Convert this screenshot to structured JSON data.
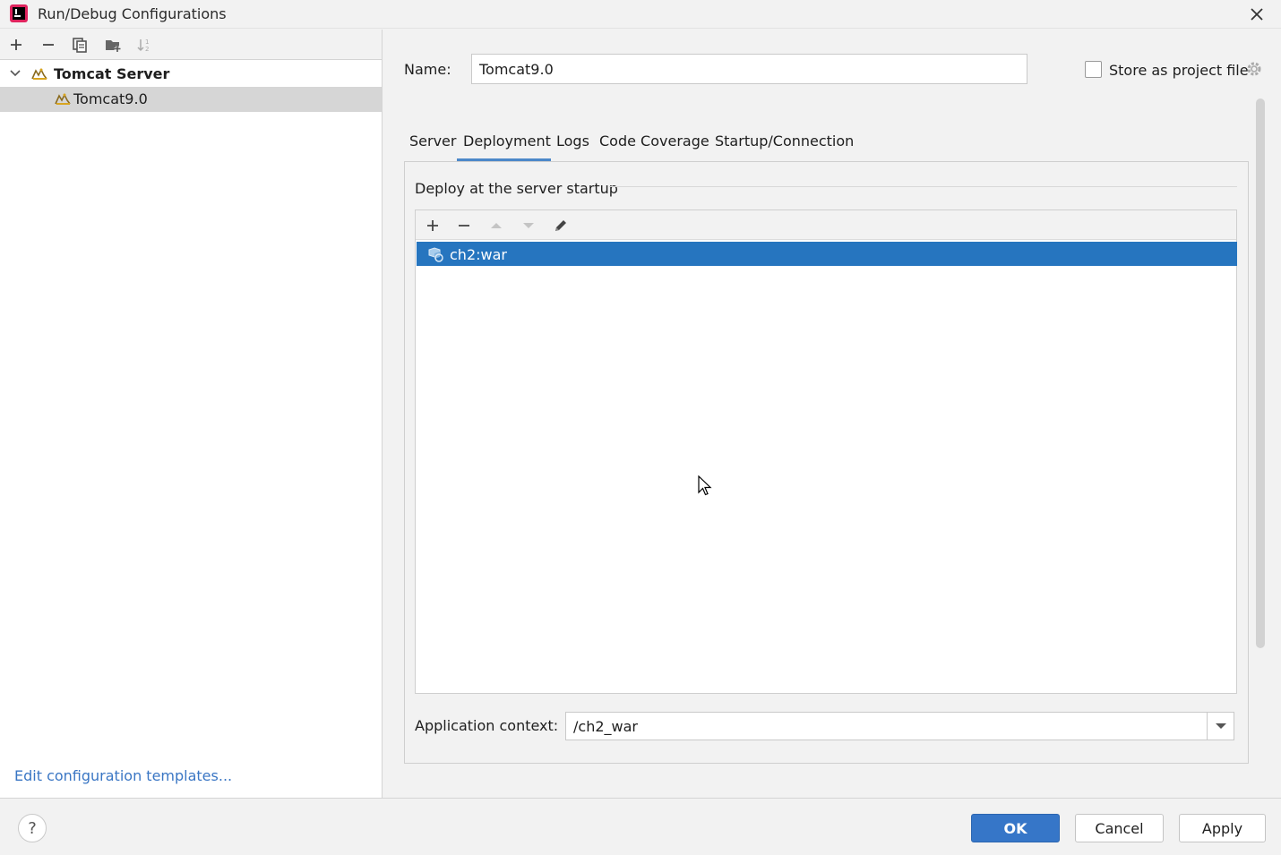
{
  "window": {
    "title": "Run/Debug Configurations",
    "app_icon": "intellij-idea-icon",
    "close_icon": "close-icon"
  },
  "left_toolbar": {
    "icons": [
      "plus-icon",
      "minus-icon",
      "copy-icon",
      "folder-add-icon",
      "sort-icon"
    ]
  },
  "tree": {
    "group": {
      "label": "Tomcat Server",
      "icon": "tomcat-icon",
      "expanded": true
    },
    "items": [
      {
        "label": "Tomcat9.0",
        "icon": "tomcat-icon",
        "selected": true
      }
    ]
  },
  "edit_templates_link": "Edit configuration templates...",
  "config": {
    "name_label": "Name:",
    "name_value": "Tomcat9.0",
    "store_as_project_file": {
      "label": "Store as project file",
      "checked": false
    }
  },
  "tabs": [
    {
      "label": "Server",
      "active": false
    },
    {
      "label": "Deployment",
      "active": true
    },
    {
      "label": "Logs",
      "active": false
    },
    {
      "label": "Code Coverage",
      "active": false
    },
    {
      "label": "Startup/Connection",
      "active": false
    }
  ],
  "deployment": {
    "group_title": "Deploy at the server startup",
    "toolbar_icons": [
      "plus-icon",
      "minus-icon",
      "arrow-up-icon",
      "arrow-down-icon",
      "pencil-icon"
    ],
    "artifacts": [
      {
        "label": "ch2:war",
        "icon": "artifact-icon",
        "selected": true
      }
    ],
    "app_context_label": "Application context:",
    "app_context_value": "/ch2_war"
  },
  "footer": {
    "help_label": "?",
    "ok_label": "OK",
    "cancel_label": "Cancel",
    "apply_label": "Apply"
  },
  "colors": {
    "selection": "#2675bf",
    "primary_button": "#3676c8",
    "link": "#3a76c4",
    "tab_underline": "#4c88c9"
  }
}
